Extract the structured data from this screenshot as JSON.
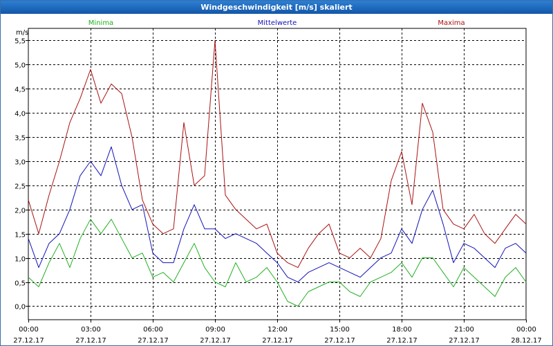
{
  "window": {
    "title": "Windgeschwindigkeit [m/s] skaliert"
  },
  "chart_data": {
    "type": "line",
    "title": "Windgeschwindigkeit [m/s] skaliert",
    "ylabel": "m/s",
    "ylim": [
      -0.28,
      5.75
    ],
    "yticks": [
      "0,0",
      "0,5",
      "1,0",
      "1,5",
      "2,0",
      "2,5",
      "3,0",
      "3,5",
      "4,0",
      "4,5",
      "5,0",
      "5,5"
    ],
    "xlim_hours": [
      0,
      24
    ],
    "xticks": [
      {
        "time": "00:00",
        "date": "27.12.17"
      },
      {
        "time": "03:00",
        "date": "27.12.17"
      },
      {
        "time": "06:00",
        "date": "27.12.17"
      },
      {
        "time": "09:00",
        "date": "27.12.17"
      },
      {
        "time": "12:00",
        "date": "27.12.17"
      },
      {
        "time": "15:00",
        "date": "27.12.17"
      },
      {
        "time": "18:00",
        "date": "27.12.17"
      },
      {
        "time": "21:00",
        "date": "27.12.17"
      },
      {
        "time": "00:00",
        "date": "28.12.17"
      }
    ],
    "grid": true,
    "legend": "top",
    "series": [
      {
        "name": "Minima",
        "color": "#22b022",
        "x": [
          0,
          0.5,
          1,
          1.5,
          2,
          2.5,
          3,
          3.5,
          4,
          4.5,
          5,
          5.5,
          6,
          6.5,
          7,
          7.5,
          8,
          8.5,
          9,
          9.5,
          10,
          10.5,
          11,
          11.5,
          12,
          12.5,
          13,
          13.5,
          14,
          14.5,
          15,
          15.5,
          16,
          16.5,
          17,
          17.5,
          18,
          18.5,
          19,
          19.5,
          20,
          20.5,
          21,
          21.5,
          22,
          22.5,
          23,
          23.5,
          24
        ],
        "values": [
          0.6,
          0.4,
          0.9,
          1.3,
          0.8,
          1.4,
          1.8,
          1.5,
          1.8,
          1.4,
          1.0,
          1.1,
          0.6,
          0.7,
          0.5,
          0.9,
          1.3,
          0.8,
          0.5,
          0.4,
          0.9,
          0.5,
          0.6,
          0.8,
          0.5,
          0.1,
          0.0,
          0.3,
          0.4,
          0.5,
          0.5,
          0.3,
          0.2,
          0.5,
          0.6,
          0.7,
          0.9,
          0.6,
          1.0,
          1.0,
          0.7,
          0.4,
          0.8,
          0.6,
          0.4,
          0.2,
          0.6,
          0.8,
          0.5
        ]
      },
      {
        "name": "Mittelwerte",
        "color": "#1212b8",
        "x": [
          0,
          0.5,
          1,
          1.5,
          2,
          2.5,
          3,
          3.5,
          4,
          4.5,
          5,
          5.5,
          6,
          6.5,
          7,
          7.5,
          8,
          8.5,
          9,
          9.5,
          10,
          10.5,
          11,
          11.5,
          12,
          12.5,
          13,
          13.5,
          14,
          14.5,
          15,
          15.5,
          16,
          16.5,
          17,
          17.5,
          18,
          18.5,
          19,
          19.5,
          20,
          20.5,
          21,
          21.5,
          22,
          22.5,
          23,
          23.5,
          24
        ],
        "values": [
          1.4,
          0.8,
          1.3,
          1.5,
          2.0,
          2.7,
          3.0,
          2.7,
          3.3,
          2.5,
          2.0,
          2.1,
          1.1,
          0.9,
          0.9,
          1.6,
          2.1,
          1.6,
          1.6,
          1.4,
          1.5,
          1.4,
          1.3,
          1.1,
          0.9,
          0.6,
          0.5,
          0.7,
          0.8,
          0.9,
          0.8,
          0.7,
          0.6,
          0.8,
          1.0,
          1.1,
          1.6,
          1.3,
          2.0,
          2.4,
          1.7,
          0.9,
          1.3,
          1.2,
          1.0,
          0.8,
          1.2,
          1.3,
          1.1
        ]
      },
      {
        "name": "Maxima",
        "color": "#aa1111",
        "x": [
          0,
          0.5,
          1,
          1.5,
          2,
          2.5,
          3,
          3.5,
          4,
          4.5,
          5,
          5.5,
          6,
          6.5,
          7,
          7.5,
          8,
          8.5,
          9,
          9.5,
          10,
          10.5,
          11,
          11.5,
          12,
          12.5,
          13,
          13.5,
          14,
          14.5,
          15,
          15.5,
          16,
          16.5,
          17,
          17.5,
          18,
          18.5,
          19,
          19.5,
          20,
          20.5,
          21,
          21.5,
          22,
          22.5,
          23,
          23.5,
          24
        ],
        "values": [
          2.2,
          1.5,
          2.3,
          3.0,
          3.8,
          4.3,
          4.9,
          4.2,
          4.6,
          4.4,
          3.5,
          2.2,
          1.7,
          1.5,
          1.6,
          3.8,
          2.5,
          2.7,
          5.5,
          2.3,
          2.0,
          1.8,
          1.6,
          1.7,
          1.1,
          0.9,
          0.8,
          1.2,
          1.5,
          1.7,
          1.1,
          1.0,
          1.2,
          1.0,
          1.4,
          2.6,
          3.2,
          2.1,
          4.2,
          3.6,
          2.0,
          1.7,
          1.6,
          1.9,
          1.5,
          1.3,
          1.6,
          1.9,
          1.7
        ]
      }
    ]
  }
}
